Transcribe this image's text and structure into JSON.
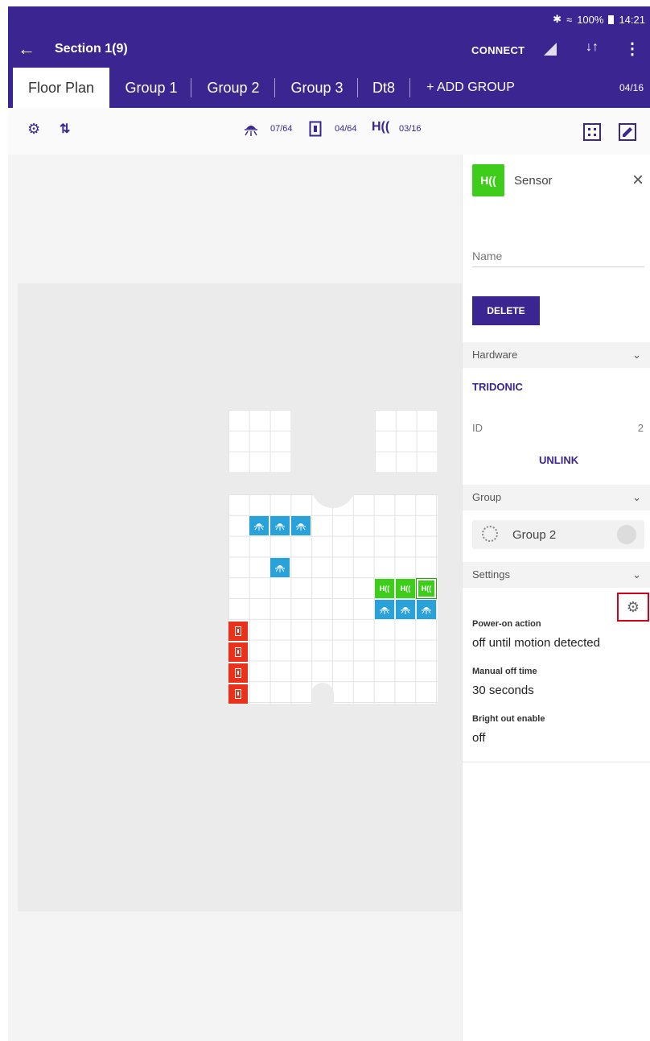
{
  "status": {
    "battery": "100%",
    "time": "14:21"
  },
  "appbar": {
    "title": "Section 1(9)",
    "connect_label": "CONNECT"
  },
  "tabs": [
    {
      "label": "Floor Plan"
    },
    {
      "label": "Group 1"
    },
    {
      "label": "Group 2"
    },
    {
      "label": "Group 3"
    },
    {
      "label": "Dt8"
    }
  ],
  "add_group_label": "+ ADD GROUP",
  "group_count": "04/16",
  "counters": {
    "lights": "07/64",
    "switches": "04/64",
    "sensors": "03/16"
  },
  "panel": {
    "device_type": "Sensor",
    "name_placeholder": "Name",
    "delete_label": "DELETE",
    "hardware_header": "Hardware",
    "hardware_vendor": "TRIDONIC",
    "id_label": "ID",
    "id_value": "2",
    "unlink_label": "UNLINK",
    "group_header": "Group",
    "group_name": "Group 2",
    "settings_header": "Settings",
    "settings": [
      {
        "label": "Power-on action",
        "value": "off until motion detected"
      },
      {
        "label": "Manual off time",
        "value": "30 seconds"
      },
      {
        "label": "Bright out enable",
        "value": "off"
      }
    ]
  },
  "colors": {
    "primary": "#3a2591",
    "light": "#29a1d9",
    "sensor": "#3fcd1c",
    "switch": "#e8321b",
    "highlight": "#d0021b"
  }
}
